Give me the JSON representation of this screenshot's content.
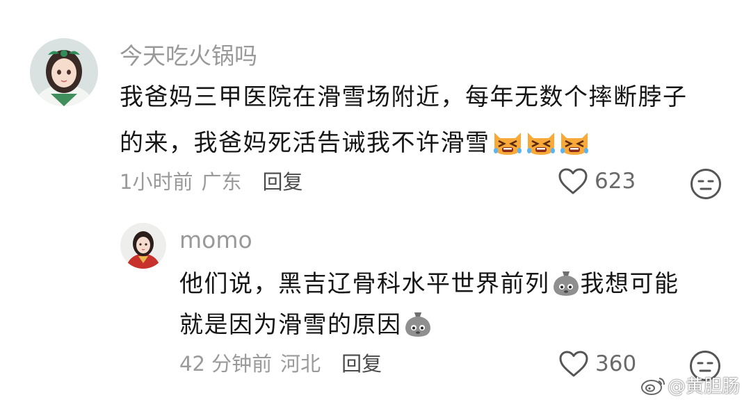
{
  "comment": {
    "username": "今天吃火锅吗",
    "text_line1": "我爸妈三甲医院在滑雪场附近，每年无数个摔断脖子",
    "text_line2": "的来，我爸妈死活告诫我不许滑雪",
    "emojis": [
      "crying-cat-emoji",
      "crying-cat-emoji",
      "crying-cat-emoji"
    ],
    "time": "1小时前",
    "location": "广东",
    "reply_label": "回复",
    "likes": "623"
  },
  "reply": {
    "username": "momo",
    "text_line1": "他们说，黑吉辽骨科水平世界前列",
    "text_line1_b": "我想可能",
    "text_line2": "就是因为滑雪的原因",
    "emojis": [
      "potato-face-emoji",
      "potato-face-emoji"
    ],
    "time": "42 分钟前",
    "location": "河北",
    "reply_label": "回复",
    "likes": "360"
  },
  "watermark": {
    "text": "@黄胆肠",
    "icon": "weibo-icon"
  },
  "colors": {
    "text": "#161616",
    "meta": "#9a9a9a",
    "username": "#999999"
  }
}
